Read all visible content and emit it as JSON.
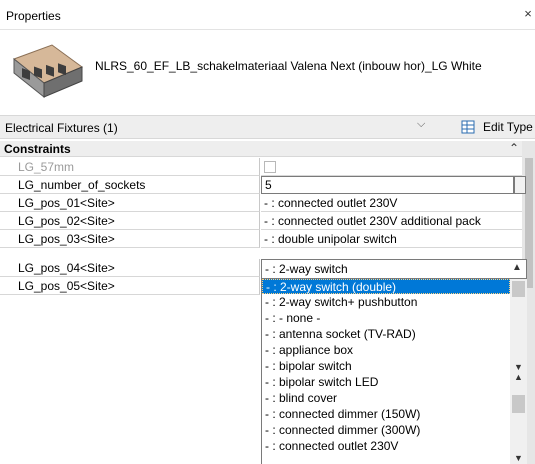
{
  "panel": {
    "title": "Properties",
    "close_glyph": "×"
  },
  "type_selector": {
    "name": "NLRS_60_EF_LB_schakelmateriaal Valena Next (inbouw hor)_LG White"
  },
  "instance_filter": {
    "label": "Electrical Fixtures (1)",
    "edit_type_label": "Edit Type"
  },
  "group": {
    "label": "Constraints",
    "collapse_glyph": "⌃"
  },
  "properties": [
    {
      "name": "LG_57mm",
      "value": ""
    },
    {
      "name": "LG_number_of_sockets",
      "value": "5"
    },
    {
      "name": "LG_pos_01<Site>",
      "value": "- : connected outlet 230V"
    },
    {
      "name": "LG_pos_02<Site>",
      "value": "- : connected outlet 230V additional pack"
    },
    {
      "name": "LG_pos_03<Site>",
      "value": "- : double unipolar switch"
    },
    {
      "name": "LG_pos_04<Site>",
      "value": "- : 2-way switch"
    },
    {
      "name": "LG_pos_05<Site>",
      "value": ""
    }
  ],
  "dropdown": {
    "options": [
      "- : 2-way switch (double)",
      "- : 2-way switch+ pushbutton",
      "- : - none -",
      "- : antenna socket (TV-RAD)",
      "- : appliance box",
      "- : bipolar switch",
      "- : bipolar switch LED",
      "- : blind cover",
      "- : connected dimmer (150W)",
      "- : connected dimmer (300W)",
      "- : connected outlet 230V"
    ],
    "selected_index": 0
  },
  "colors": {
    "selection": "#0078d7",
    "panel_header": "#eeeeee",
    "accent_icon": "#2b6cb0"
  },
  "icons": {
    "edit_type": "edit-type-icon",
    "dropdown": "chevron-down-icon",
    "scroll_up": "chevron-up-icon",
    "scroll_down": "chevron-down-icon"
  }
}
